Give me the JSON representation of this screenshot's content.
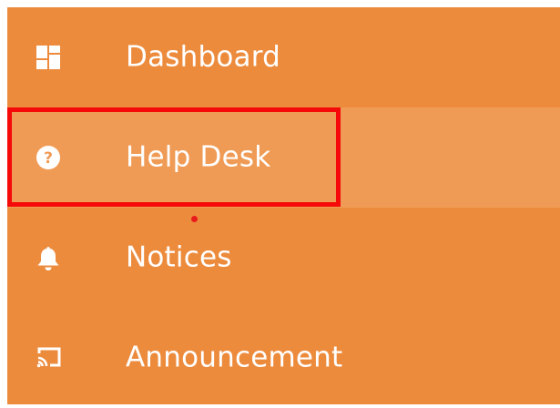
{
  "sidebar": {
    "background_color": "#ED8B3D",
    "active_background_color": "#F09B55",
    "items": [
      {
        "label": "Dashboard",
        "icon": "dashboard-icon",
        "active": false
      },
      {
        "label": "Help Desk",
        "icon": "help-circle-icon",
        "active": true
      },
      {
        "label": "Notices",
        "icon": "bell-icon",
        "active": false
      },
      {
        "label": "Announcement",
        "icon": "cast-icon",
        "active": false
      }
    ]
  },
  "highlight": {
    "target": "Help Desk",
    "color": "#F50909"
  }
}
